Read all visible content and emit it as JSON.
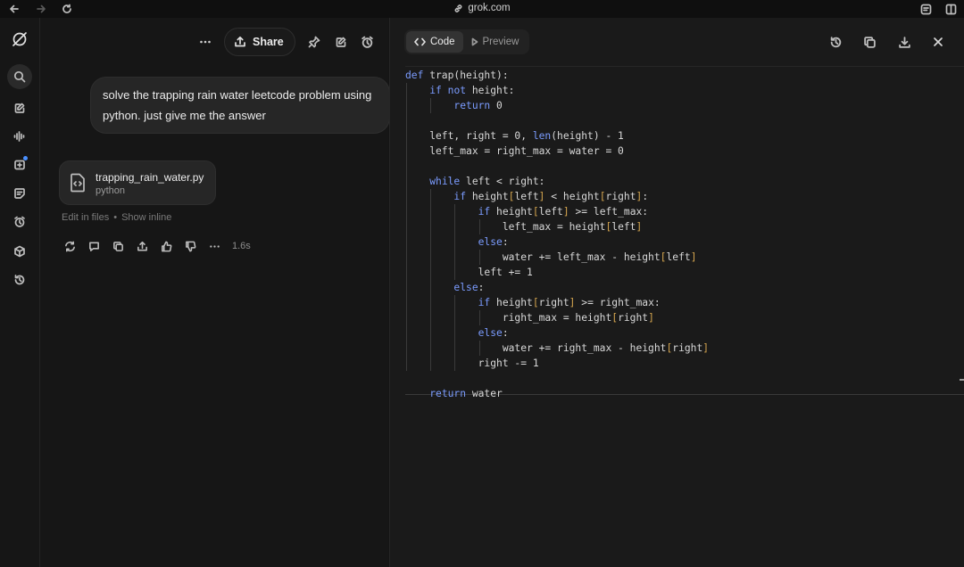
{
  "browser": {
    "url": "grok.com"
  },
  "chat": {
    "share_label": "Share",
    "user_message": "solve the trapping rain water leetcode problem using python. just give me the answer",
    "file": {
      "name": "trapping_rain_water.py",
      "language": "python"
    },
    "edit_link": "Edit in files",
    "separator": "•",
    "show_inline_link": "Show inline",
    "response_time": "1.6s"
  },
  "code_panel": {
    "tabs": [
      {
        "label": "Code",
        "active": true
      },
      {
        "label": "Preview",
        "active": false
      }
    ],
    "lines": [
      "def trap(height):",
      "    if not height:",
      "        return 0",
      "",
      "    left, right = 0, len(height) - 1",
      "    left_max = right_max = water = 0",
      "",
      "    while left < right:",
      "        if height[left] < height[right]:",
      "            if height[left] >= left_max:",
      "                left_max = height[left]",
      "            else:",
      "                water += left_max - height[left]",
      "            left += 1",
      "        else:",
      "            if height[right] >= right_max:",
      "                right_max = height[right]",
      "            else:",
      "                water += right_max - height[right]",
      "            right -= 1",
      "",
      "    return water"
    ]
  },
  "icons": {
    "nav": [
      "grok-logo-icon",
      "search-icon",
      "edit-icon",
      "voice-icon",
      "workspace-icon",
      "notes-icon",
      "tasks-icon",
      "projects-icon",
      "history-icon"
    ],
    "code_panel": [
      "history-icon",
      "copy-icon",
      "download-icon",
      "close-icon"
    ]
  },
  "colors": {
    "background": "#141414",
    "panel": "#1a1a1a",
    "keyword": "#7b9cff",
    "bracket": "#d6a64f",
    "notification_dot": "#4a90ff"
  }
}
